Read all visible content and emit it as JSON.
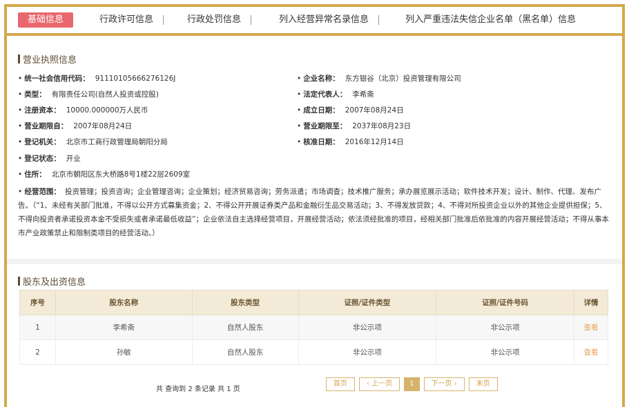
{
  "tabs": [
    {
      "label": "基础信息",
      "active": true
    },
    {
      "label": "行政许可信息"
    },
    {
      "label": "行政处罚信息"
    },
    {
      "label": "列入经营异常名录信息"
    },
    {
      "label": "列入严重违法失信企业名单（黑名单）信息"
    }
  ],
  "license": {
    "title": "营业执照信息",
    "fields": {
      "credit_code": {
        "label": "统一社会信用代码：",
        "value": "91110105666276126J"
      },
      "company_name": {
        "label": "企业名称：",
        "value": "东方银谷（北京）投资管理有限公司"
      },
      "type": {
        "label": "类型：",
        "value": "有限责任公司(自然人投资或控股)"
      },
      "legal_rep": {
        "label": "法定代表人：",
        "value": "李希斋"
      },
      "reg_capital": {
        "label": "注册资本：",
        "value": "10000.000000万人民币"
      },
      "est_date": {
        "label": "成立日期：",
        "value": "2007年08月24日"
      },
      "term_from": {
        "label": "营业期限自：",
        "value": "2007年08月24日"
      },
      "term_to": {
        "label": "营业期限至：",
        "value": "2037年08月23日"
      },
      "authority": {
        "label": "登记机关：",
        "value": "北京市工商行政管理局朝阳分局"
      },
      "approve_date": {
        "label": "核准日期：",
        "value": "2016年12月14日"
      },
      "status": {
        "label": "登记状态：",
        "value": "开业"
      },
      "address": {
        "label": "住所：",
        "value": "北京市朝阳区东大桥路8号1楼22层2609室"
      }
    },
    "scope": {
      "label": "经营范围：",
      "value": "投资管理；投资咨询；企业管理咨询；企业策划；经济贸易咨询；劳务派遣；市场调查；技术推广服务；承办展览展示活动；软件技术开发；设计、制作、代理、发布广告。（“1、未经有关部门批准，不得以公开方式募集资金；2、不得公开开展证券类产品和金融衍生品交易活动；3、不得发放贷款；4、不得对所投资企业以外的其他企业提供担保；5、不得向投资者承诺投资本金不受损失或者承诺最低收益”；企业依法自主选择经营项目，开展经营活动；依法须经批准的项目，经相关部门批准后依批准的内容开展经营活动；不得从事本市产业政策禁止和限制类项目的经营活动。）"
    }
  },
  "shareholders": {
    "title": "股东及出资信息",
    "headers": [
      "序号",
      "股东名称",
      "股东类型",
      "证照/证件类型",
      "证照/证件号码",
      "详情"
    ],
    "rows": [
      [
        "1",
        "李希斋",
        "自然人股东",
        "非公示项",
        "非公示项",
        "查看"
      ],
      [
        "2",
        "孙敏",
        "自然人股东",
        "非公示项",
        "非公示项",
        "查看"
      ]
    ],
    "pager": {
      "summary": "共 查询到 2 条记录 共 1 页",
      "first": "首页",
      "prev": "‹ 上一页",
      "current": "1",
      "next": "下一页 ›",
      "last": "末页"
    }
  }
}
